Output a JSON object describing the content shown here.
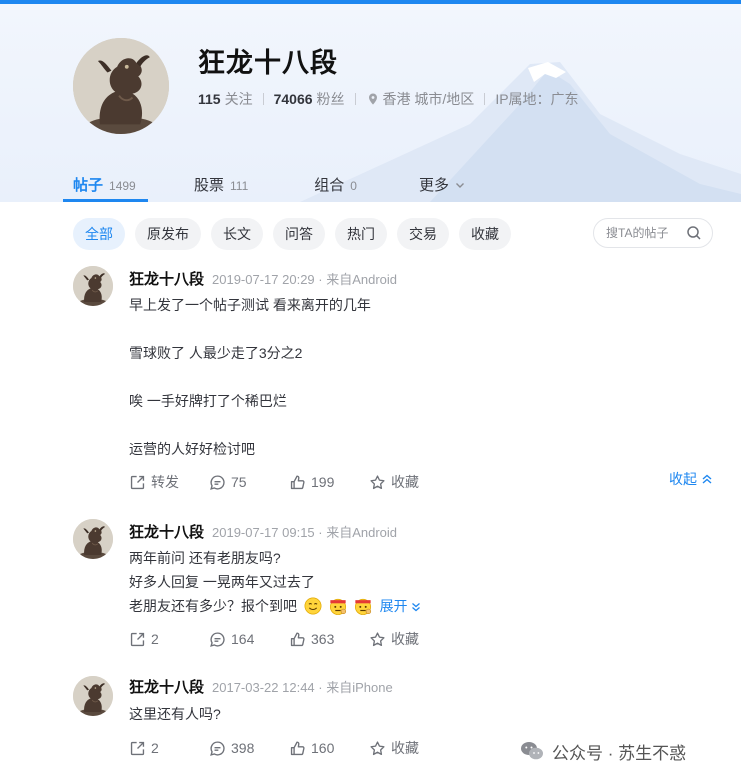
{
  "profile": {
    "name": "狂龙十八段",
    "following_count": "115",
    "following_label": "关注",
    "followers_count": "74066",
    "followers_label": "粉丝",
    "location": "香港 城市/地区",
    "ip_location": "IP属地：广东"
  },
  "tabs": [
    {
      "label": "帖子",
      "count": "1499"
    },
    {
      "label": "股票",
      "count": "111"
    },
    {
      "label": "组合",
      "count": "0"
    },
    {
      "label": "更多",
      "count": ""
    }
  ],
  "filters": [
    "全部",
    "原发布",
    "长文",
    "问答",
    "热门",
    "交易",
    "收藏"
  ],
  "search": {
    "placeholder": "搜TA的帖子"
  },
  "posts": [
    {
      "author": "狂龙十八段",
      "meta": "2019-07-17 20:29 · 来自Android",
      "paragraphs": [
        "早上发了一个帖子测试 看来离开的几年",
        "",
        "雪球败了 人最少走了3分之2",
        "",
        "唉 一手好牌打了个稀巴烂",
        "",
        "运营的人好好检讨吧"
      ],
      "repost": "转发",
      "comments": "75",
      "likes": "199",
      "favorite": "收藏",
      "collapse": "收起"
    },
    {
      "author": "狂龙十八段",
      "meta": "2019-07-17 09:15 · 来自Android",
      "paragraphs": [
        "两年前问 还有老朋友吗?",
        "好多人回复 一晃两年又过去了",
        "老朋友还有多少？报个到吧"
      ],
      "expand": "展开",
      "repost": "2",
      "comments": "164",
      "likes": "363",
      "favorite": "收藏"
    },
    {
      "author": "狂龙十八段",
      "meta": "2017-03-22 12:44 · 来自iPhone",
      "paragraphs": [
        "这里还有人吗?"
      ],
      "repost": "2",
      "comments": "398",
      "likes": "160",
      "favorite": "收藏"
    }
  ],
  "watermark": "公众号 · 苏生不惑",
  "colors": {
    "accent": "#1e87f0",
    "chip_bg": "#f2f3f5",
    "chip_active_bg": "#e7f1fd"
  },
  "icons": [
    "location-pin-icon",
    "chevron-down-icon",
    "search-icon",
    "repost-icon",
    "comment-icon",
    "like-icon",
    "star-icon",
    "chevron-up-icon",
    "wechat-icon"
  ]
}
